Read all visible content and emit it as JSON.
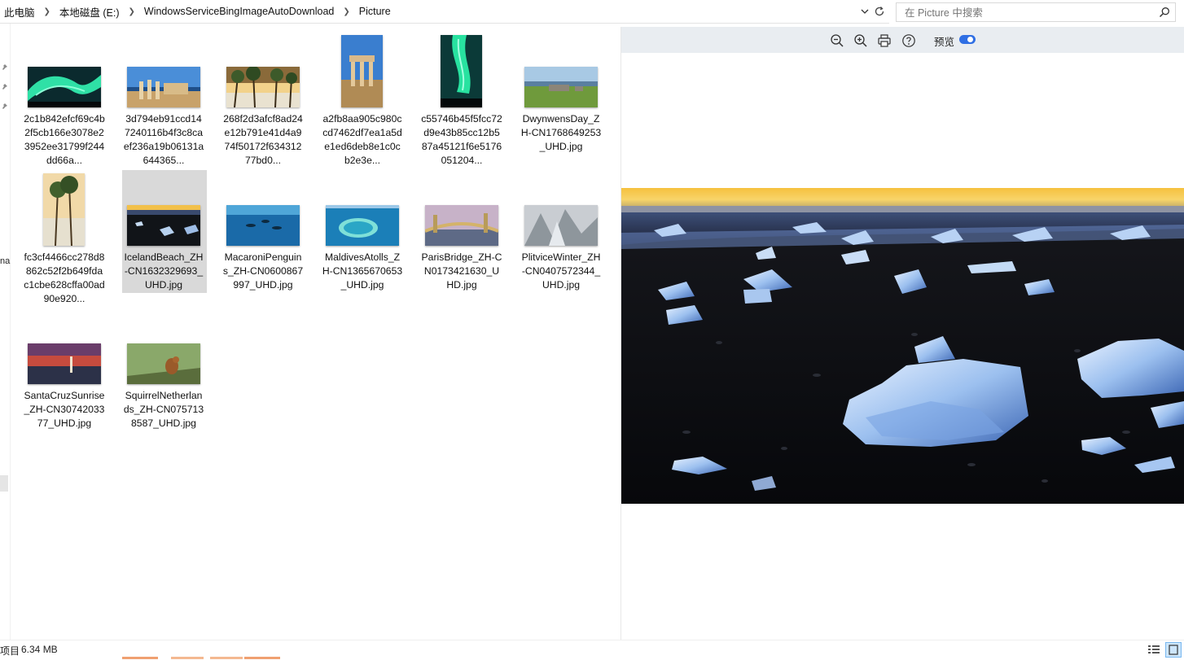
{
  "address_bar": {
    "crumbs": [
      "此电脑",
      "本地磁盘 (E:)",
      "WindowsServiceBingImageAutoDownload",
      "Picture"
    ]
  },
  "search": {
    "placeholder": "在 Picture 中搜索"
  },
  "nav": {
    "cut_label": "na"
  },
  "files": [
    {
      "name": "2c1b842efcf69c4b2f5cb166e3078e23952ee31799f244dd66a...",
      "icon": "aurora-thumbnail"
    },
    {
      "name": "3d794eb91ccd147240116b4f3c8caef236a19b06131a644365...",
      "icon": "ruins-coast-thumbnail"
    },
    {
      "name": "268f2d3afcf8ad24e12b791e41d4a974f50172f63431277bd0...",
      "icon": "palm-beach-thumbnail"
    },
    {
      "name": "a2fb8aa905c980ccd7462df7ea1a5de1ed6deb8e1c0cb2e3e...",
      "icon": "temple-columns-thumbnail"
    },
    {
      "name": "c55746b45f5fcc72d9e43b85cc12b587a45121f6e5176051204...",
      "icon": "aurora-portrait-thumbnail"
    },
    {
      "name": "DwynwensDay_ZH-CN1768649253_UHD.jpg",
      "icon": "coastal-ruins-thumbnail"
    },
    {
      "name": "fc3cf4466cc278d8862c52f2b649fdac1cbe628cffa00ad90e920...",
      "icon": "palm-portrait-thumbnail"
    },
    {
      "name": "IcelandBeach_ZH-CN1632329693_UHD.jpg",
      "icon": "ice-beach-thumbnail",
      "selected": true
    },
    {
      "name": "MacaroniPenguins_ZH-CN0600867997_UHD.jpg",
      "icon": "underwater-penguins-thumbnail"
    },
    {
      "name": "MaldivesAtolls_ZH-CN1365670653_UHD.jpg",
      "icon": "atoll-thumbnail"
    },
    {
      "name": "ParisBridge_ZH-CN0173421630_UHD.jpg",
      "icon": "paris-bridge-thumbnail"
    },
    {
      "name": "PlitviceWinter_ZH-CN0407572344_UHD.jpg",
      "icon": "frozen-falls-thumbnail"
    },
    {
      "name": "SantaCruzSunrise_ZH-CN3074203377_UHD.jpg",
      "icon": "sunrise-lighthouse-thumbnail"
    },
    {
      "name": "SquirrelNetherlands_ZH-CN0757138587_UHD.jpg",
      "icon": "squirrel-thumbnail"
    }
  ],
  "preview": {
    "toggle_label": "预览",
    "toggle_on": true,
    "image_icon": "iceland-beach-preview"
  },
  "status": {
    "count_label": "项目",
    "size": "6.34 MB"
  },
  "colors": {
    "accent": "#2f6fe4",
    "selection": "#d9d9d9",
    "toolbar": "#e9edf1"
  }
}
